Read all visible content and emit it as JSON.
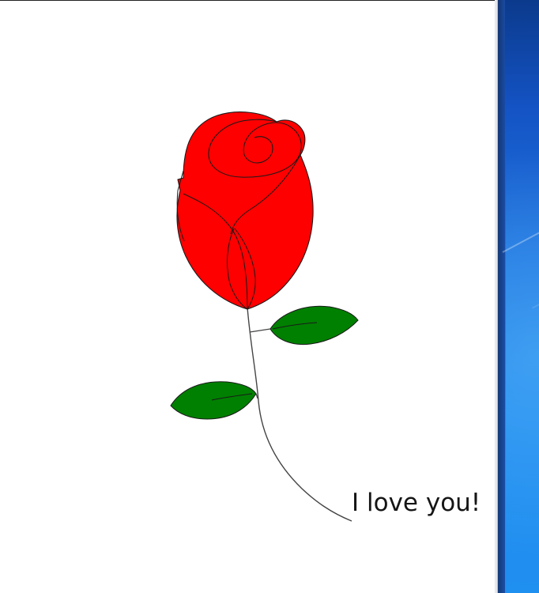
{
  "message": {
    "text": "I love you!"
  },
  "colors": {
    "petal": "#ff0000",
    "leaf": "#008000",
    "stem": "#444444",
    "outline": "#1a1a1a",
    "desktop": "#1f88ef",
    "window_bg": "#ffffff"
  },
  "icons": {
    "main_drawing": "rose-illustration"
  }
}
